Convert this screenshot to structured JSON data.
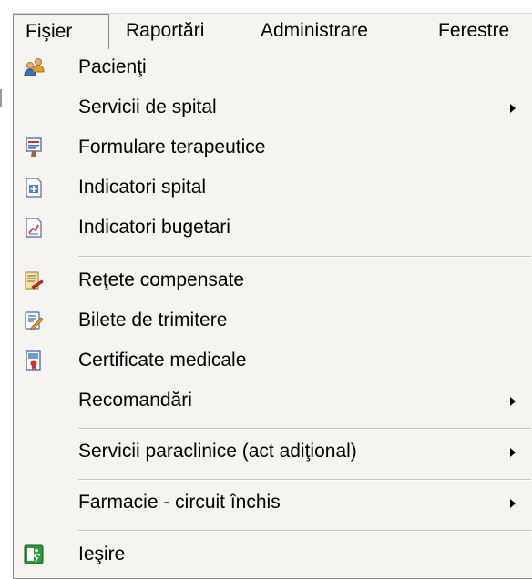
{
  "menubar": {
    "items": [
      {
        "label": "Fişier"
      },
      {
        "label": "Raportări"
      },
      {
        "label": "Administrare"
      },
      {
        "label": "Ferestre"
      }
    ]
  },
  "dropdown": {
    "items": [
      {
        "label": "Pacienţi",
        "icon": "patients-icon",
        "submenu": false
      },
      {
        "label": "Servicii de spital",
        "icon": null,
        "submenu": true
      },
      {
        "label": "Formulare terapeutice",
        "icon": "forms-icon",
        "submenu": false
      },
      {
        "label": "Indicatori spital",
        "icon": "hospital-indicators-icon",
        "submenu": false
      },
      {
        "label": "Indicatori bugetari",
        "icon": "budget-indicators-icon",
        "submenu": false
      },
      {
        "label": "Reţete compensate",
        "icon": "prescriptions-icon",
        "submenu": false
      },
      {
        "label": "Bilete de trimitere",
        "icon": "referral-tickets-icon",
        "submenu": false
      },
      {
        "label": "Certificate medicale",
        "icon": "medical-certificate-icon",
        "submenu": false
      },
      {
        "label": "Recomandări",
        "icon": null,
        "submenu": true
      },
      {
        "label": "Servicii paraclinice (act adiţional)",
        "icon": null,
        "submenu": true
      },
      {
        "label": "Farmacie - circuit închis",
        "icon": null,
        "submenu": true
      },
      {
        "label": "Ieşire",
        "icon": "exit-icon",
        "submenu": false
      }
    ]
  },
  "colors": {
    "menu_background": "#f5f4f1",
    "border": "#8a8a8a",
    "separator": "#c5c5c5",
    "exit_icon_green": "#2a9a3a"
  }
}
